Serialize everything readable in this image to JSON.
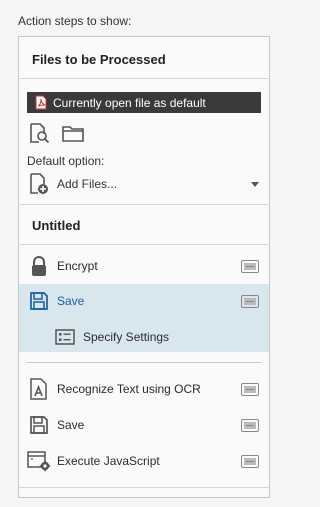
{
  "header": {
    "label": "Action steps to show:"
  },
  "files_section": {
    "title": "Files to be Processed",
    "current_file": "Currently open file as default",
    "default_option_label": "Default option:",
    "add_files_label": "Add Files..."
  },
  "untitled_section": {
    "title": "Untitled",
    "actions": [
      {
        "label": "Encrypt"
      },
      {
        "label": "Save"
      },
      {
        "label": "Specify Settings"
      },
      {
        "label": "Recognize Text using OCR"
      },
      {
        "label": "Save"
      },
      {
        "label": "Execute JavaScript"
      }
    ]
  },
  "icons": {
    "pdf": "pdf-file-icon",
    "search_file": "search-file-icon",
    "folder": "folder-icon",
    "add_file": "add-file-icon",
    "dropdown": "chevron-down-icon",
    "lock": "lock-icon",
    "save": "save-icon",
    "settings": "settings-list-icon",
    "ocr": "ocr-text-icon",
    "javascript": "javascript-icon",
    "instructions": "instructions-toggle-icon"
  },
  "colors": {
    "selected_background": "#d8e6ee",
    "selected_text": "#1a5fa6",
    "file_bar": "#3a3a3a",
    "pdf_red": "#d0312d"
  }
}
